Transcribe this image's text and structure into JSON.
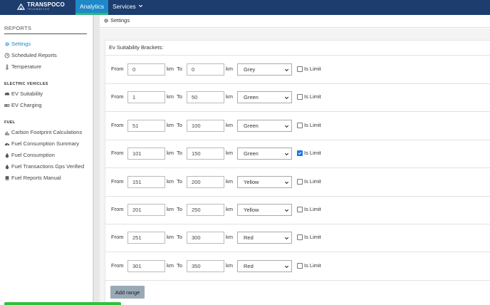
{
  "header": {
    "logo_name": "TRANSPOCO",
    "logo_sub": "TELEMATICS",
    "nav_analytics": "Analytics",
    "nav_services": "Services",
    "brand_color": "#1c3d6e",
    "active_color": "#1e88c8"
  },
  "sidebar": {
    "title": "REPORTS",
    "items": [
      {
        "label": "Settings",
        "icon": "gear-icon"
      },
      {
        "label": "Scheduled Reports",
        "icon": "clock-icon"
      },
      {
        "label": "Temperature",
        "icon": "thermometer-icon"
      }
    ],
    "ev_section": "ELECTRIC VEHICLES",
    "ev_items": [
      {
        "label": "EV Suitability",
        "icon": "car-icon"
      },
      {
        "label": "EV Charging",
        "icon": "battery-icon"
      }
    ],
    "fuel_section": "FUEL",
    "fuel_items": [
      {
        "label": "Carbon Footprint Calculations",
        "icon": "bar-chart-icon"
      },
      {
        "label": "Fuel Consumption Summary",
        "icon": "dashboard-icon"
      },
      {
        "label": "Fuel Consumption",
        "icon": "drop-icon"
      },
      {
        "label": "Fuel Transactions Gps Verified",
        "icon": "drop-icon"
      },
      {
        "label": "Fuel Reports Manual",
        "icon": "book-icon"
      }
    ]
  },
  "breadcrumb": "Settings",
  "form": {
    "title": "Ev Suitability Brackets:",
    "from_label": "From",
    "km_label": "km",
    "to_label": "To",
    "limit_label": "Is Limit",
    "rows": [
      {
        "from": "0",
        "to": "0",
        "color": "Grey",
        "is_limit": false
      },
      {
        "from": "1",
        "to": "50",
        "color": "Green",
        "is_limit": false
      },
      {
        "from": "51",
        "to": "100",
        "color": "Green",
        "is_limit": false
      },
      {
        "from": "101",
        "to": "150",
        "color": "Green",
        "is_limit": true
      },
      {
        "from": "151",
        "to": "200",
        "color": "Yellow",
        "is_limit": false
      },
      {
        "from": "201",
        "to": "250",
        "color": "Yellow",
        "is_limit": false
      },
      {
        "from": "251",
        "to": "300",
        "color": "Red",
        "is_limit": false
      },
      {
        "from": "301",
        "to": "350",
        "color": "Red",
        "is_limit": false
      }
    ],
    "add_button": "Add range"
  }
}
